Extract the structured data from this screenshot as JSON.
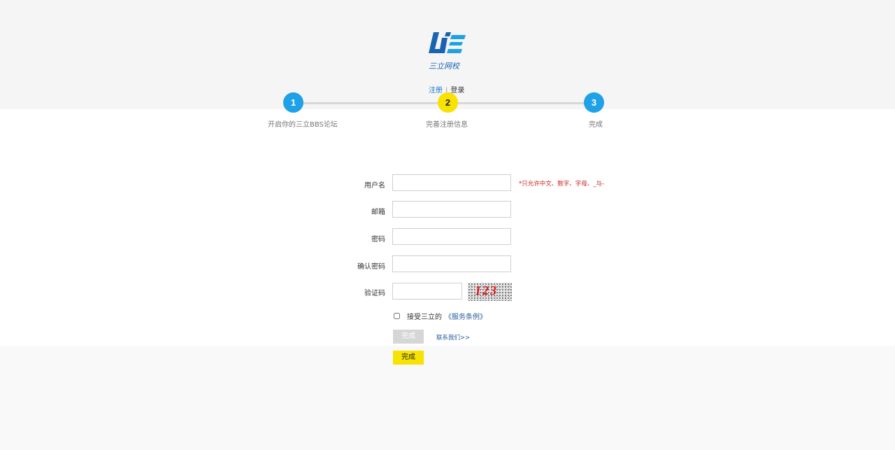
{
  "brand": {
    "logo_name": "三立网校"
  },
  "auth": {
    "register": "注册",
    "separator": "|",
    "login": "登录"
  },
  "steps": [
    {
      "number": "1",
      "label": "开启你的三立BBS论坛"
    },
    {
      "number": "2",
      "label": "完善注册信息"
    },
    {
      "number": "3",
      "label": "完成"
    }
  ],
  "form": {
    "username_label": "用户名",
    "username_hint": "*只允许中文、数字、字母、_与-",
    "email_label": "邮箱",
    "password_label": "密码",
    "confirm_label": "确认密码",
    "captcha_label": "验证码",
    "captcha_text": "123",
    "agree_text": "接受三立的",
    "terms_link": "《服务条例》",
    "submit_disabled": "完成",
    "contact_link": "联系我们>>",
    "submit_active": "完成"
  },
  "colors": {
    "accent_blue": "#1ea1e6",
    "accent_yellow": "#f7e200",
    "hint_red": "#cc1f1f"
  }
}
